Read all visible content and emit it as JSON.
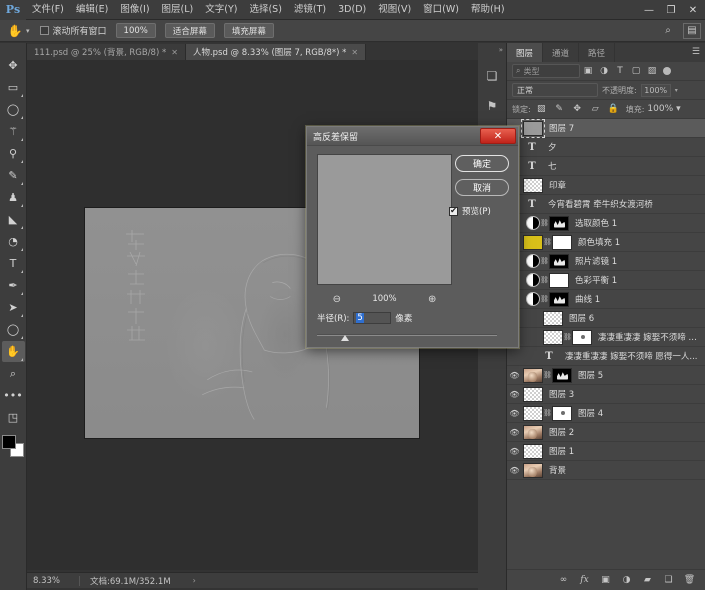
{
  "app": {
    "logo": "Ps",
    "menus": [
      {
        "label": "文件(F)"
      },
      {
        "label": "编辑(E)"
      },
      {
        "label": "图像(I)"
      },
      {
        "label": "图层(L)"
      },
      {
        "label": "文字(Y)"
      },
      {
        "label": "选择(S)"
      },
      {
        "label": "滤镜(T)"
      },
      {
        "label": "3D(D)"
      },
      {
        "label": "视图(V)"
      },
      {
        "label": "窗口(W)"
      },
      {
        "label": "帮助(H)"
      }
    ],
    "window_controls": {
      "minimize": "—",
      "maximize": "❐",
      "close": "✕"
    }
  },
  "options_bar": {
    "tool_icon": "✋",
    "tool_caret": "▾",
    "scroll_all_windows": "滚动所有窗口",
    "zoom_100": "100%",
    "fit_screen": "适合屏幕",
    "fill_screen": "填充屏幕",
    "right_icons": [
      "search-icon",
      "workspace-icon"
    ]
  },
  "tabs": [
    {
      "label": "111.psd @ 25% (背景, RGB/8) *",
      "active": false,
      "close": "✕"
    },
    {
      "label": "人物.psd @ 8.33% (图层 7, RGB/8*) *",
      "active": true,
      "close": "✕"
    }
  ],
  "toolbar": {
    "tools": [
      {
        "name": "move-tool",
        "glyph": "✥"
      },
      {
        "name": "marquee-tool",
        "glyph": "▭"
      },
      {
        "name": "lasso-tool",
        "glyph": "◯"
      },
      {
        "name": "magic-wand-tool",
        "glyph": "✨"
      },
      {
        "name": "eyedropper-tool",
        "glyph": "✒"
      },
      {
        "name": "brush-tool",
        "glyph": "✎"
      },
      {
        "name": "clone-stamp-tool",
        "glyph": "♟"
      },
      {
        "name": "eraser-tool",
        "glyph": "◣"
      },
      {
        "name": "paint-bucket-tool",
        "glyph": "◔"
      },
      {
        "name": "type-tool",
        "glyph": "T"
      },
      {
        "name": "pen-tool",
        "glyph": "✑"
      },
      {
        "name": "path-selection-tool",
        "glyph": "➤"
      },
      {
        "name": "ellipse-tool",
        "glyph": "◯"
      },
      {
        "name": "hand-tool",
        "glyph": "✋"
      },
      {
        "name": "zoom-tool",
        "glyph": "⌕"
      },
      {
        "name": "more-tools",
        "glyph": "•••"
      },
      {
        "name": "quick-mask",
        "glyph": "◳"
      }
    ],
    "foreground_color": "#000000",
    "background_color": "#ffffff"
  },
  "status_bar": {
    "zoom": "8.33%",
    "doc_info": "文档:69.1M/352.1M",
    "arrow": "›"
  },
  "dock_strip": {
    "icons": [
      "libraries-icon",
      "adjustments-icon",
      "styles-icon"
    ],
    "collapse": "»"
  },
  "layers_panel": {
    "tabs": [
      {
        "label": "图层",
        "active": true
      },
      {
        "label": "通道",
        "active": false
      },
      {
        "label": "路径",
        "active": false
      }
    ],
    "menu_icon": "☰",
    "filter": {
      "search_icon": "⌕",
      "kind_label": "类型",
      "icons": [
        "pixel-filter-icon",
        "adjustment-filter-icon",
        "type-filter-icon",
        "shape-filter-icon",
        "smart-object-filter-icon"
      ],
      "toggle": "filter-toggle"
    },
    "blend": {
      "mode": "正常",
      "opacity_label": "不透明度:",
      "opacity_value": "100%",
      "spinner": "▾"
    },
    "lock": {
      "label": "锁定:",
      "icons": [
        "lock-transparent-icon",
        "lock-image-icon",
        "lock-position-icon",
        "lock-artboard-icon",
        "lock-all-icon"
      ],
      "fill_label": "填充:",
      "fill_value": "100%",
      "spinner": "▾"
    },
    "layers": [
      {
        "name": "图层 7",
        "visible": false,
        "selected": true,
        "thumb": "gray",
        "kind": "pixel",
        "linked": false
      },
      {
        "name": "夕",
        "visible": false,
        "selected": false,
        "thumb": "none",
        "kind": "type",
        "linked": false
      },
      {
        "name": "七",
        "visible": false,
        "selected": false,
        "thumb": "none",
        "kind": "type",
        "linked": false
      },
      {
        "name": "印章",
        "visible": false,
        "selected": false,
        "thumb": "stamp",
        "kind": "pixel",
        "linked": false
      },
      {
        "name": "今宵看碧霄 牵牛织女渡河桥",
        "visible": false,
        "selected": false,
        "thumb": "none",
        "kind": "type",
        "linked": false
      },
      {
        "name": "选取颜色 1",
        "visible": false,
        "selected": false,
        "thumb": "adj",
        "kind": "adjustment",
        "linked": true,
        "mask": "black"
      },
      {
        "name": "颜色填充 1",
        "visible": false,
        "selected": false,
        "thumb": "solid-yellow",
        "kind": "fill",
        "linked": true,
        "mask": "white"
      },
      {
        "name": "照片滤镜 1",
        "visible": false,
        "selected": false,
        "thumb": "adj",
        "kind": "adjustment",
        "linked": true,
        "mask": "black"
      },
      {
        "name": "色彩平衡 1",
        "visible": false,
        "selected": false,
        "thumb": "adj",
        "kind": "adjustment",
        "linked": true,
        "mask": "white"
      },
      {
        "name": "曲线 1",
        "visible": false,
        "selected": false,
        "thumb": "adj",
        "kind": "adjustment",
        "linked": true,
        "mask": "curve"
      },
      {
        "name": "图层 6",
        "visible": false,
        "selected": false,
        "thumb": "transparent",
        "kind": "pixel",
        "linked": false
      },
      {
        "name": "凄凄重凄凄 嫁娶不须啼 愿...",
        "visible": false,
        "selected": false,
        "thumb": "transparent",
        "kind": "pixel",
        "linked": true,
        "mask": "white"
      },
      {
        "name": "凄凄重凄凄 嫁娶不须啼 愿得一人...",
        "visible": false,
        "selected": false,
        "thumb": "none",
        "kind": "type",
        "linked": false
      },
      {
        "name": "图层 5",
        "visible": true,
        "selected": false,
        "thumb": "photo",
        "kind": "pixel",
        "linked": true,
        "mask": "black"
      },
      {
        "name": "图层 3",
        "visible": true,
        "selected": false,
        "thumb": "transparent",
        "kind": "pixel",
        "linked": false
      },
      {
        "name": "图层 4",
        "visible": true,
        "selected": false,
        "thumb": "transparent",
        "kind": "pixel",
        "linked": true,
        "mask": "white"
      },
      {
        "name": "图层 2",
        "visible": true,
        "selected": false,
        "thumb": "photo",
        "kind": "pixel",
        "linked": false
      },
      {
        "name": "图层 1",
        "visible": true,
        "selected": false,
        "thumb": "transparent",
        "kind": "pixel",
        "linked": false
      },
      {
        "name": "背景",
        "visible": true,
        "selected": false,
        "thumb": "photo",
        "kind": "pixel",
        "linked": false
      }
    ],
    "footer_icons": [
      "link-layers-icon",
      "layer-style-icon",
      "layer-mask-icon",
      "adjustment-layer-icon",
      "new-group-icon",
      "new-layer-icon",
      "delete-layer-icon"
    ],
    "footer_glyphs": [
      "∞",
      "fx",
      "▣",
      "◑",
      "▬",
      "❑",
      "🗑"
    ]
  },
  "dialog": {
    "title": "高反差保留",
    "close": "✕",
    "ok": "确定",
    "cancel": "取消",
    "preview_label": "预览(P)",
    "preview_checked": "✔",
    "zoom_out_icon": "⊖",
    "zoom_level": "100%",
    "zoom_in_icon": "⊕",
    "radius_label": "半径(R):",
    "radius_value": "5",
    "radius_unit": "像素"
  }
}
